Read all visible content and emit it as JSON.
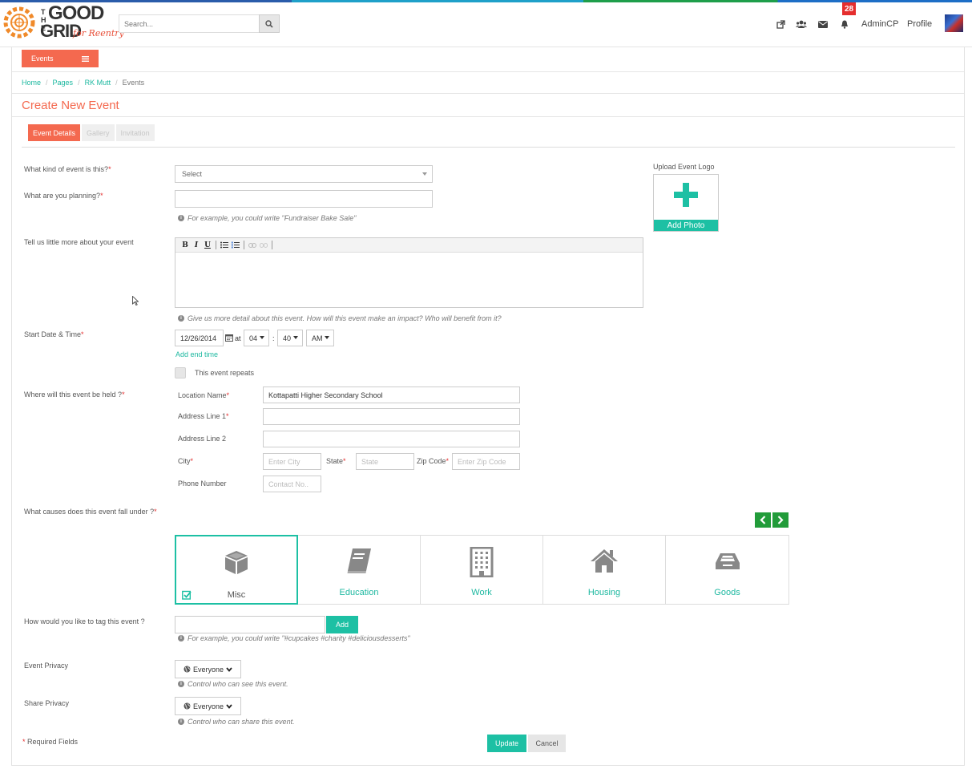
{
  "brand": {
    "the": "THE",
    "good": "GOOD",
    "grid": "GRID",
    "tagline": "for Reentry",
    "accent": "#f4694f",
    "teal": "#1dc0a4"
  },
  "header": {
    "search_placeholder": "Search...",
    "notification_count": "28",
    "admin_label": "AdminCP",
    "profile_label": "Profile"
  },
  "nav": {
    "events_label": "Events"
  },
  "breadcrumb": [
    "Home",
    "Pages",
    "RK Mutt",
    "Events"
  ],
  "page_title": "Create New Event",
  "tabs": [
    "Event Details",
    "Gallery",
    "Invitation"
  ],
  "form": {
    "kind": {
      "label": "What kind of event is this?",
      "value": "Select"
    },
    "planning": {
      "label": "What are you planning?",
      "hint": "For example, you could write \"Fundraiser Bake Sale\""
    },
    "description": {
      "label": "Tell us little more about your event",
      "hint": "Give us more detail about this event. How will this event make an impact? Who will benefit from it?"
    },
    "start": {
      "label": "Start Date & Time",
      "date": "12/26/2014",
      "at": "at",
      "hour": "04",
      "colon": ":",
      "minute": "40",
      "ampm": "AM",
      "add_end_time": "Add end time",
      "repeats_label": "This event repeats"
    },
    "location": {
      "label": "Where will this event be held ?",
      "name_label": "Location Name",
      "name_value": "Kottapatti Higher Secondary School",
      "address1_label": "Address Line 1",
      "address2_label": "Address Line 2",
      "city_label": "City",
      "city_placeholder": "Enter City",
      "state_label": "State",
      "state_placeholder": "State",
      "zip_label": "Zip Code",
      "zip_placeholder": "Enter Zip Code",
      "phone_label": "Phone Number",
      "phone_placeholder": "Contact No.."
    },
    "causes": {
      "label": "What causes does this event fall under ?",
      "items": [
        "Misc",
        "Education",
        "Work",
        "Housing",
        "Goods"
      ],
      "selected": "Misc"
    },
    "tags": {
      "label": "How would you like to tag this event ?",
      "add_label": "Add",
      "hint": "For example, you could write \"#cupcakes #charity #deliciousdesserts\""
    },
    "event_privacy": {
      "label": "Event Privacy",
      "value": "Everyone",
      "hint": "Control who can see this event."
    },
    "share_privacy": {
      "label": "Share Privacy",
      "value": "Everyone",
      "hint": "Control who can share this event."
    },
    "required_note": "Required Fields",
    "required_mark": "*",
    "update_label": "Update",
    "cancel_label": "Cancel"
  },
  "upload": {
    "label": "Upload Event Logo",
    "button_label": "Add Photo"
  }
}
